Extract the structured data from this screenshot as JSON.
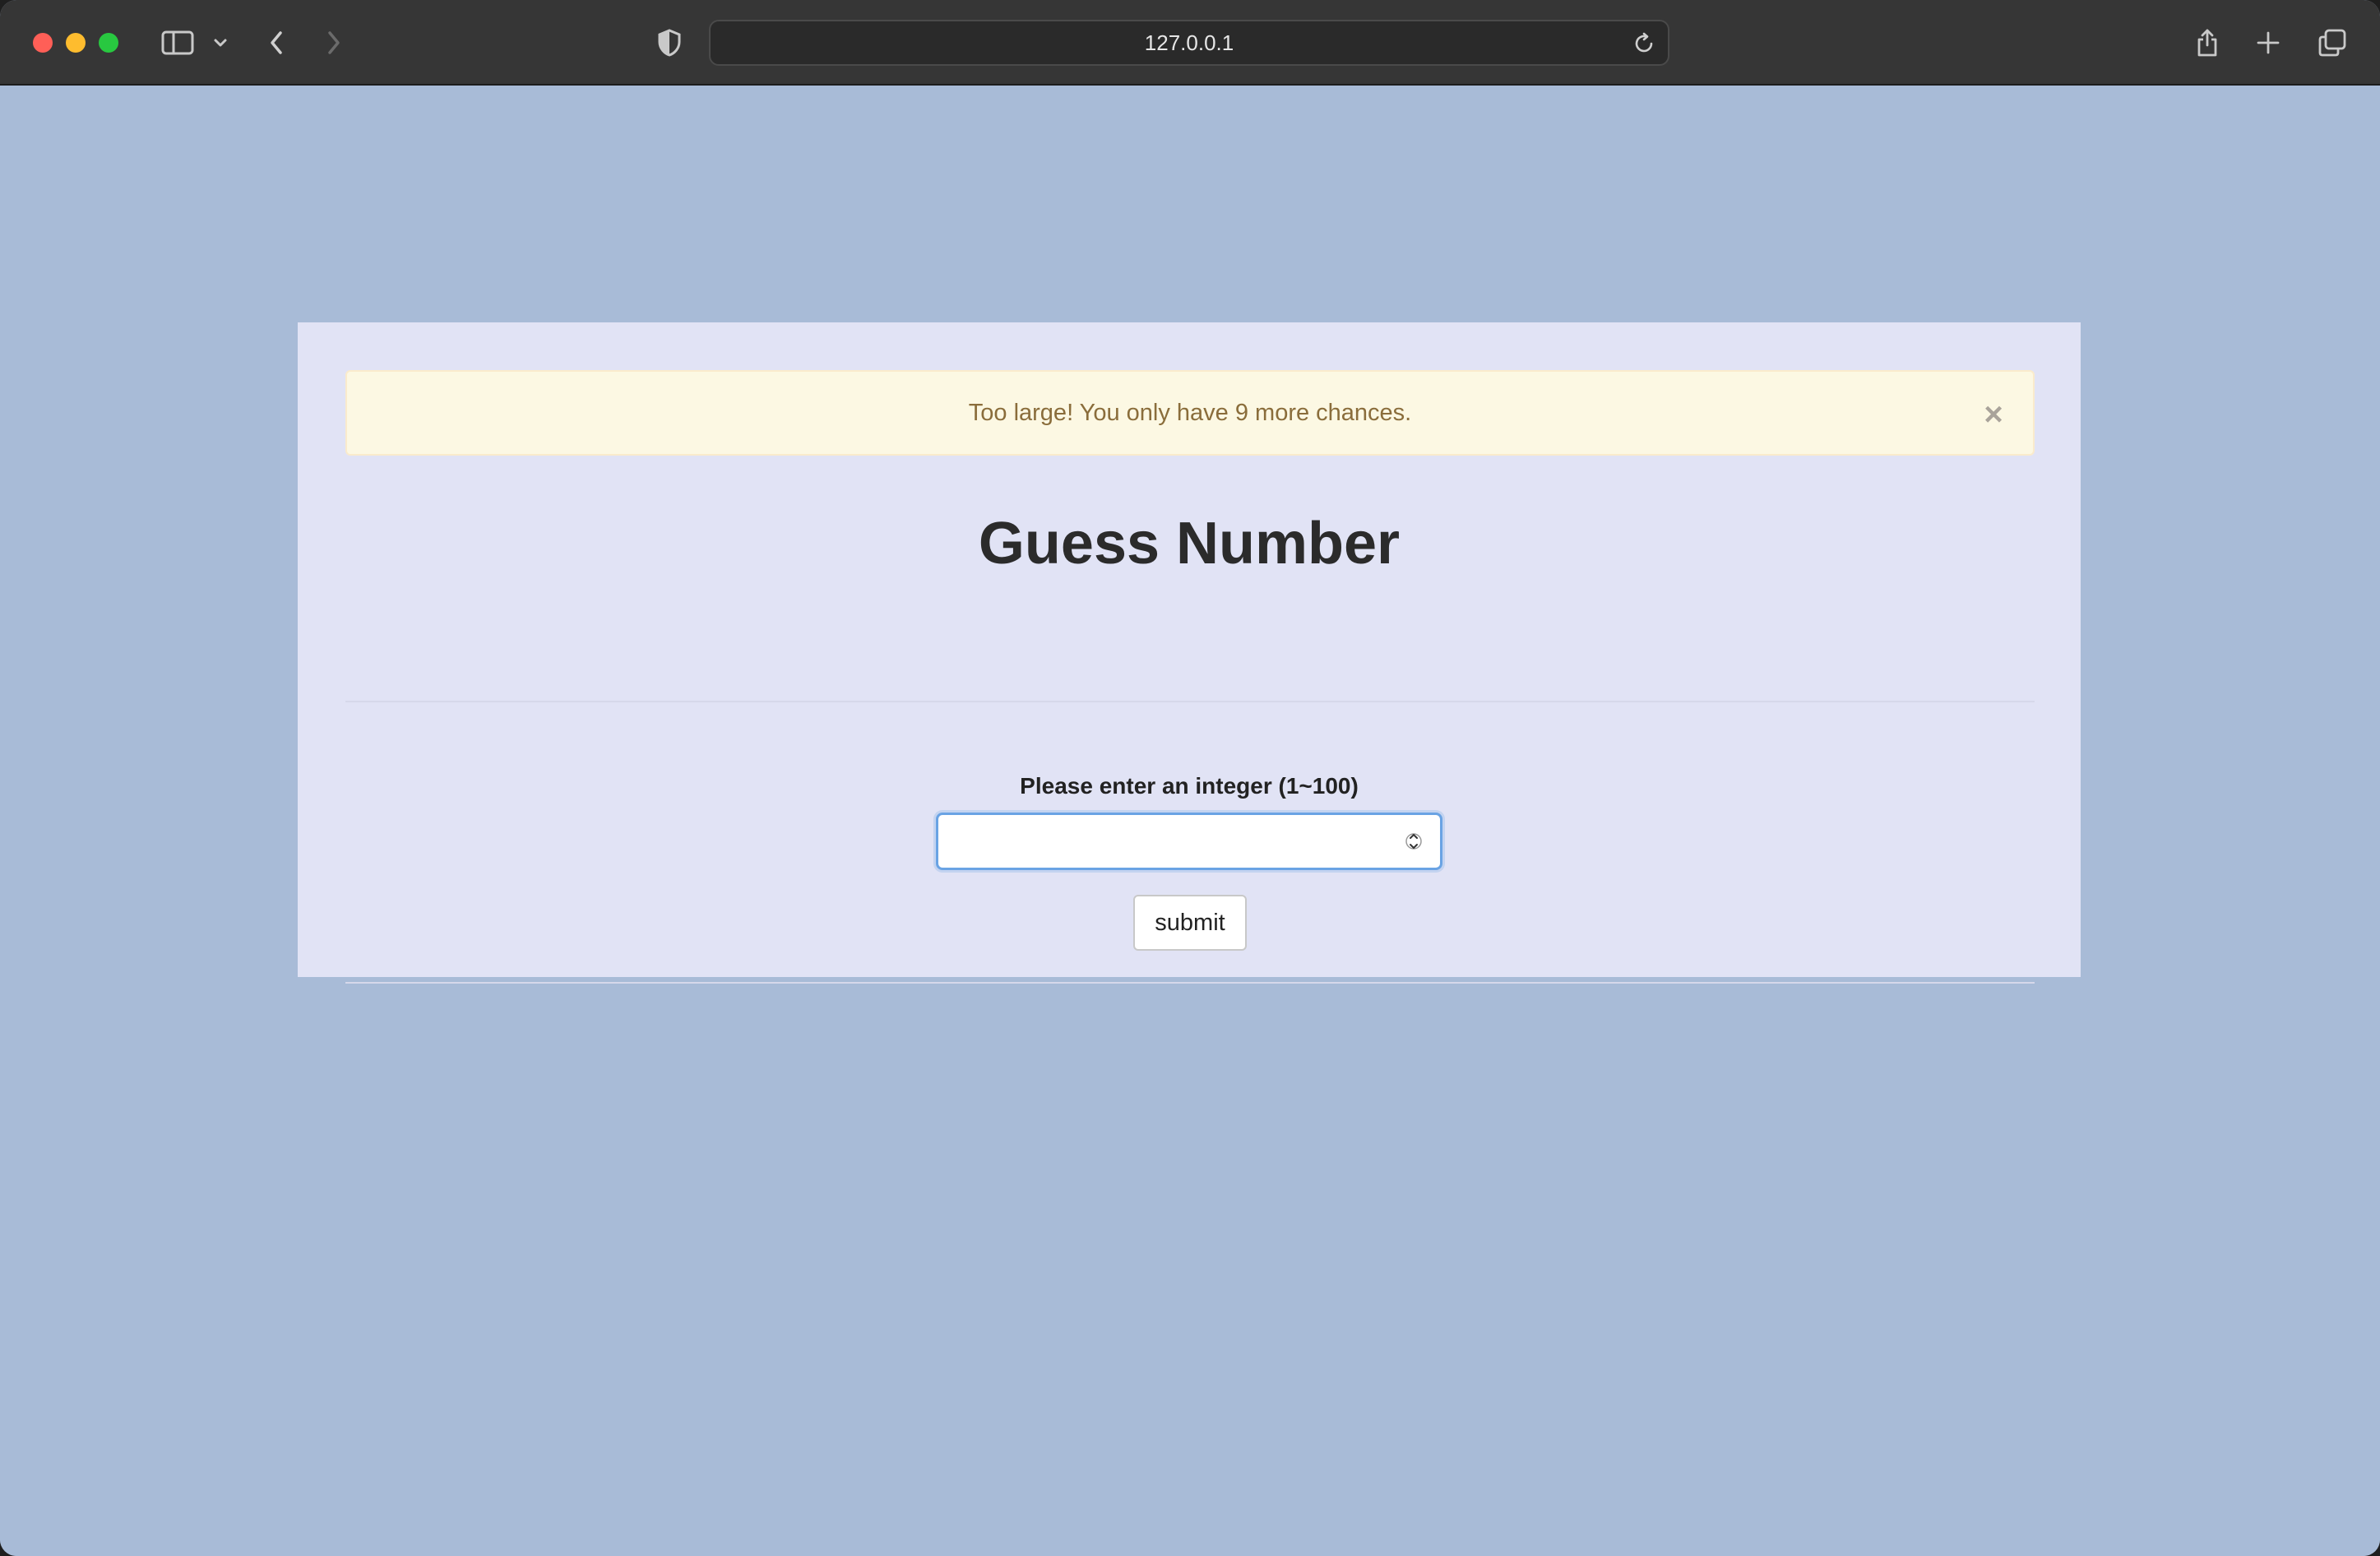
{
  "browser": {
    "address": "127.0.0.1",
    "icons": {
      "sidebar": "sidebar-icon",
      "chevron": "chevron-down-icon",
      "back": "back-icon",
      "forward": "forward-icon",
      "shield": "shield-icon",
      "reload": "reload-icon",
      "share": "share-icon",
      "new_tab": "plus-icon",
      "tabs": "tabs-overview-icon"
    }
  },
  "alert": {
    "message": "Too large!  You only have 9 more chances.",
    "close_glyph": "×"
  },
  "page": {
    "title": "Guess Number",
    "field_label": "Please enter an integer (1~100)",
    "input_value": "",
    "submit_label": "submit"
  },
  "colors": {
    "page_background": "#a8bbd7",
    "card_background": "#e1e3f5",
    "alert_background": "#fcf8e3",
    "alert_text": "#8a6d3b",
    "input_focus_border": "#6aa3e4"
  }
}
